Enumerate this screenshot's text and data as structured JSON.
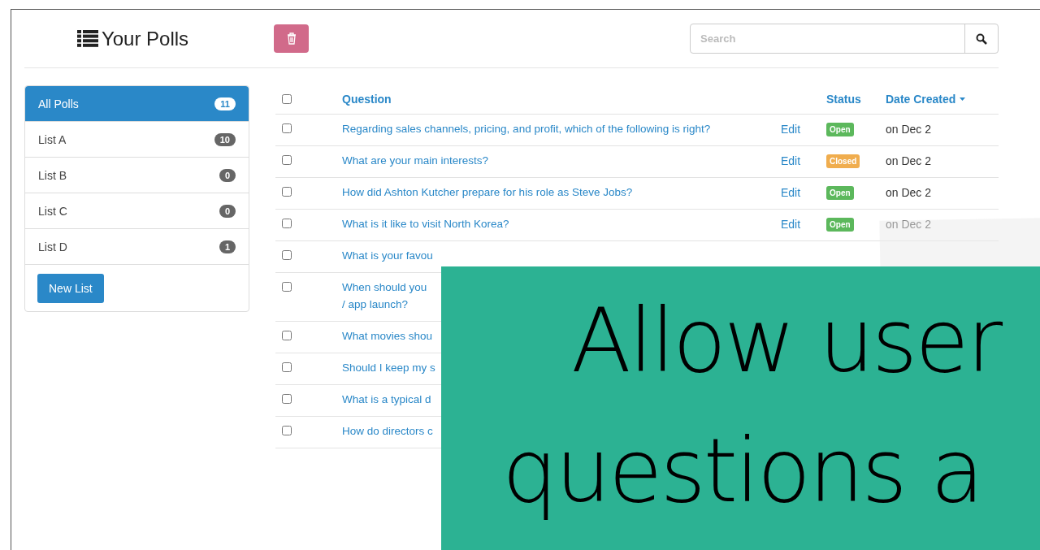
{
  "header": {
    "title": "Your Polls",
    "search": {
      "placeholder": "Search"
    }
  },
  "sidebar": {
    "items": [
      {
        "label": "All Polls",
        "count": "11",
        "selected": true
      },
      {
        "label": "List A",
        "count": "10",
        "selected": false
      },
      {
        "label": "List B",
        "count": "0",
        "selected": false
      },
      {
        "label": "List C",
        "count": "0",
        "selected": false
      },
      {
        "label": "List D",
        "count": "1",
        "selected": false
      }
    ],
    "button": "New List"
  },
  "table": {
    "select_all_checked": false,
    "columns": [
      "Question",
      "Status",
      "Date Created"
    ],
    "rows": [
      {
        "checked": false,
        "question": "Regarding sales channels, pricing, and profit, which of the following is right?",
        "edit": "Edit",
        "status": {
          "label": "Open",
          "color": "#5cb85c"
        },
        "date": "on Dec 2"
      },
      {
        "checked": false,
        "question": "What are your main interests?",
        "edit": "Edit",
        "status": {
          "label": "Closed",
          "color": "#f0ad4e"
        },
        "date": "on Dec 2"
      },
      {
        "checked": false,
        "question": "How did Ashton Kutcher prepare for his role as Steve Jobs?",
        "edit": "Edit",
        "status": {
          "label": "Open",
          "color": "#5cb85c"
        },
        "date": "on Dec 2"
      },
      {
        "checked": false,
        "question": "What is it like to visit North Korea?",
        "edit": "Edit",
        "status": {
          "label": "Open",
          "color": "#5cb85c"
        },
        "date": "on Dec 2"
      },
      {
        "checked": false,
        "question": "What is your favou"
      },
      {
        "checked": false,
        "question": "When should you\n/ app launch?"
      },
      {
        "checked": false,
        "question": "What movies shou"
      },
      {
        "checked": false,
        "question": "Should I keep my s"
      },
      {
        "checked": false,
        "question": "What is a typical d"
      },
      {
        "checked": false,
        "question": "How do directors c"
      }
    ]
  },
  "banner": {
    "lines": [
      "Allow user",
      "questions a"
    ]
  }
}
